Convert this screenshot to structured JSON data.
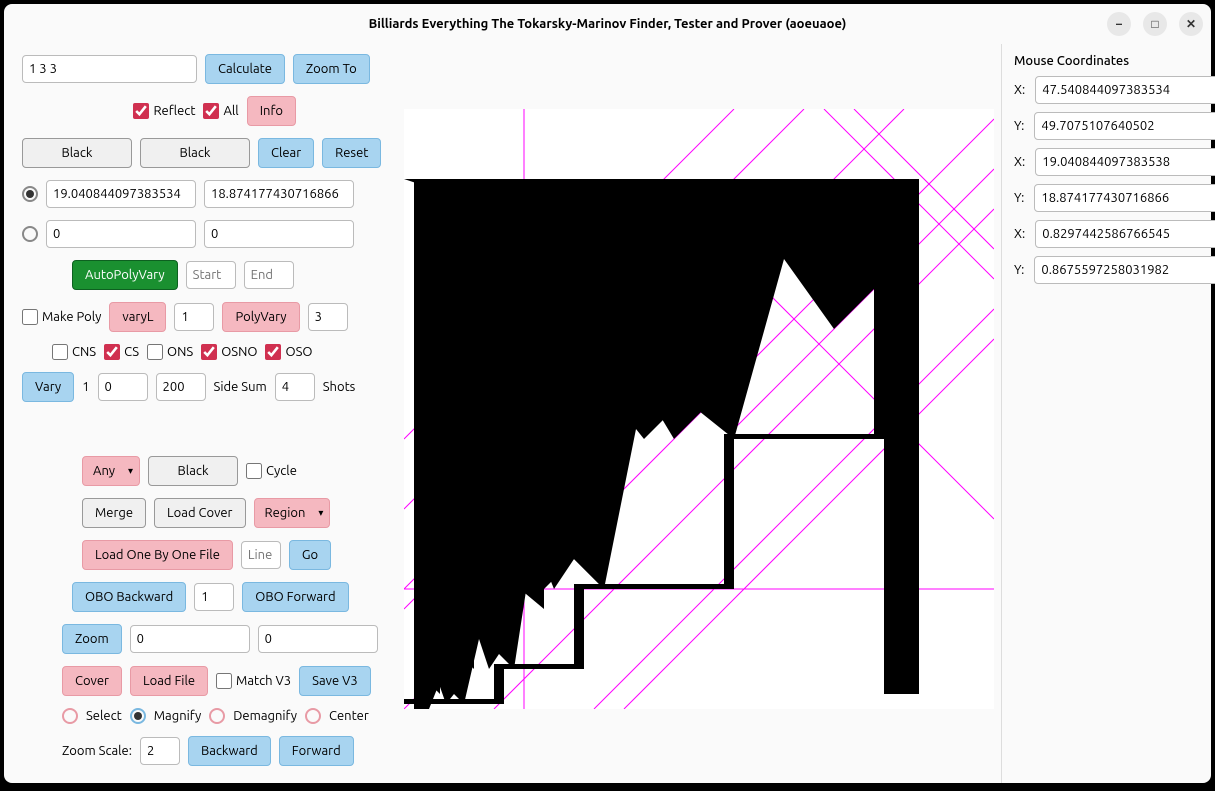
{
  "title": "Billiards Everything The Tokarsky-Marinov Finder, Tester and Prover (aoeuaoe)",
  "top": {
    "expr": "1 3 3",
    "calc": "Calculate",
    "zoomto": "Zoom To"
  },
  "row2": {
    "reflect": "Reflect",
    "all": "All",
    "info": "Info"
  },
  "row3": {
    "black1": "Black",
    "black2": "Black",
    "clear": "Clear",
    "reset": "Reset"
  },
  "row4": {
    "v1": "19.040844097383534",
    "v2": "18.874177430716866"
  },
  "row5": {
    "v1": "0",
    "v2": "0"
  },
  "row6": {
    "auto": "AutoPolyVary",
    "start": "Start",
    "end": "End"
  },
  "row7": {
    "makepoly": "Make Poly",
    "varyl": "varyL",
    "v1": "1",
    "polyvary": "PolyVary",
    "v2": "3"
  },
  "row8": {
    "cns": "CNS",
    "cs": "CS",
    "ons": "ONS",
    "osno": "OSNO",
    "oso": "OSO"
  },
  "row9": {
    "vary": "Vary",
    "one": "1",
    "v1": "0",
    "v2": "200",
    "sidesum": "Side Sum",
    "v3": "4",
    "shots": "Shots"
  },
  "row10": {
    "any": "Any",
    "black": "Black",
    "cycle": "Cycle"
  },
  "row11": {
    "merge": "Merge",
    "loadcover": "Load Cover",
    "region": "Region"
  },
  "row12": {
    "loadobo": "Load One By One File",
    "line": "Line",
    "go": "Go"
  },
  "row13": {
    "oboback": "OBO Backward",
    "v": "1",
    "obofwd": "OBO Forward"
  },
  "row14": {
    "zoom": "Zoom",
    "v1": "0",
    "v2": "0"
  },
  "row15": {
    "cover": "Cover",
    "loadfile": "Load File",
    "matchv3": "Match V3",
    "savev3": "Save V3"
  },
  "row16": {
    "select": "Select",
    "magnify": "Magnify",
    "demagnify": "Demagnify",
    "center": "Center"
  },
  "row17": {
    "zoomscale": "Zoom Scale:",
    "v": "2",
    "backward": "Backward",
    "forward": "Forward"
  },
  "right": {
    "header": "Mouse Coordinates",
    "labels": [
      "X:",
      "Y:",
      "X:",
      "Y:",
      "X:",
      "Y:"
    ],
    "vals": [
      "47.540844097383534",
      "49.7075107640502",
      "19.040844097383538",
      "18.874177430716866",
      "0.8297442586766545",
      "0.8675597258031982"
    ]
  }
}
